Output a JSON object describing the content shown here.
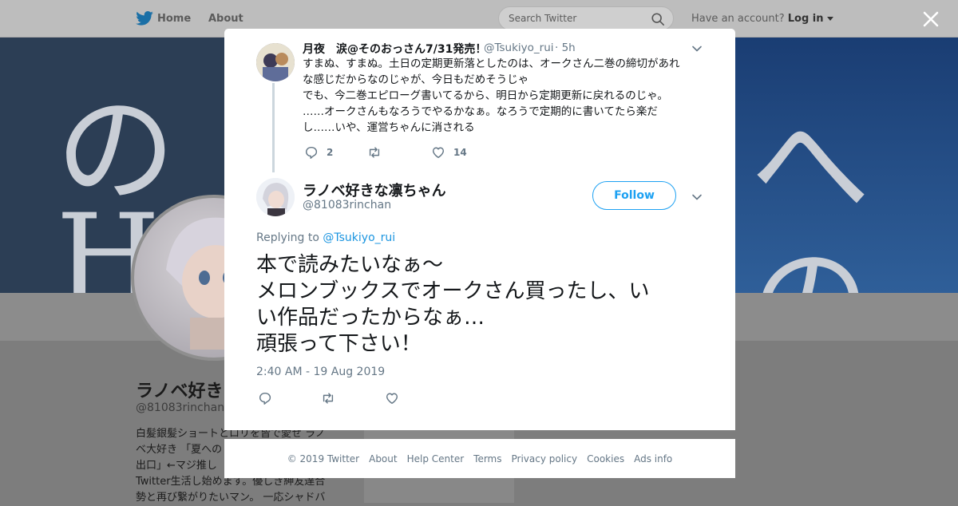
{
  "topbar": {
    "home_label": "Home",
    "about_label": "About",
    "search_placeholder": "Search Twitter",
    "have_account": "Have an account?",
    "login_label": "Log in"
  },
  "background_profile": {
    "name": "ラノベ好き…",
    "handle": "@81083rinchan",
    "bio_lines": [
      "白髪銀髪ショートとロリを皆で愛せ ラノ",
      "ベ大好き 「夏への",
      "出口」←マジ推し",
      "Twitter生活し始めます。優しき紳友達合",
      "勢と再び繋がりたいマン。 一応シャドバ"
    ],
    "banner_glyphs": [
      "の",
      "へ",
      "の",
      "H"
    ]
  },
  "parent_tweet": {
    "name": "月夜　涙@そのおっさん7/31発売！",
    "handle": "@Tsukiyo_rui",
    "time": "· 5h",
    "text_lines": [
      "すまぬ、すまぬ。土日の定期更新落としたのは、オークさん二巻の締切があれ",
      "な感じだからなのじゃが、今日もだめそうじゃ",
      "でも、今二巻エピローグ書いてるから、明日から定期更新に戻れるのじゃ。",
      "……オークさんもなろうでやるかなぁ。なろうで定期的に書いてたら楽だ",
      "し……いや、運営ちゃんに消される"
    ],
    "reply_count": "2",
    "like_count": "14"
  },
  "main_tweet": {
    "name": "ラノベ好きな凛ちゃん",
    "handle": "@81083rinchan",
    "follow_label": "Follow",
    "replying_prefix": "Replying to",
    "replying_to": "@Tsukiyo_rui",
    "text_lines": [
      "本で読みたいなぁ〜",
      "メロンブックスでオークさん買ったし、い",
      "い作品だったからなぁ…",
      "頑張って下さい！"
    ],
    "timestamp": "2:40 AM - 19 Aug 2019"
  },
  "footer": {
    "links": [
      "© 2019 Twitter",
      "About",
      "Help Center",
      "Terms",
      "Privacy policy",
      "Cookies",
      "Ads info"
    ]
  },
  "colors": {
    "accent": "#1da1f2",
    "link": "#1b95e0",
    "secondary_text": "#657786",
    "thread_line": "#ccd6dd"
  },
  "icons": [
    "twitter-bird-icon",
    "search-icon",
    "caret-down-icon",
    "close-icon",
    "reply-icon",
    "retweet-icon",
    "like-icon",
    "chevron-down-icon"
  ]
}
